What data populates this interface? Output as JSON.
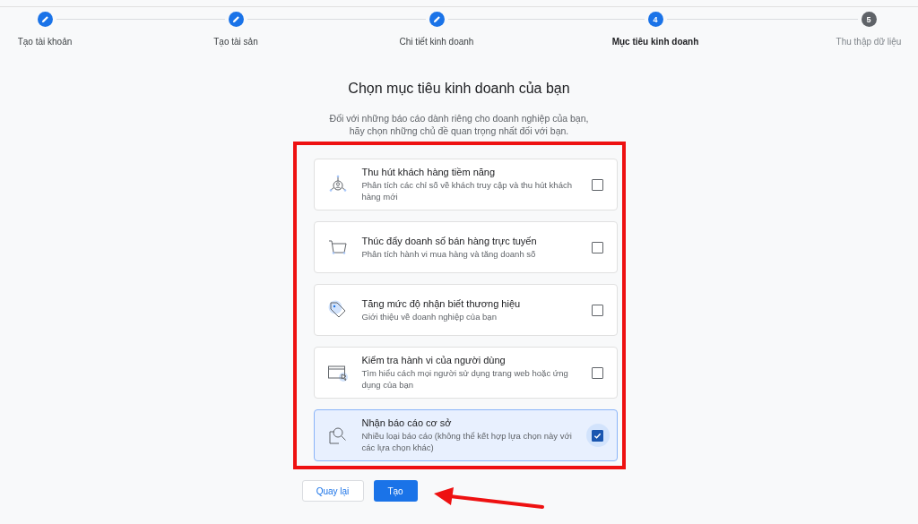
{
  "steps": [
    {
      "label": "Tạo tài khoản",
      "kind": "done"
    },
    {
      "label": "Tạo tài sản",
      "kind": "done"
    },
    {
      "label": "Chi tiết kinh doanh",
      "kind": "done"
    },
    {
      "label": "Mục tiêu kinh doanh",
      "kind": "current",
      "number": "4"
    },
    {
      "label": "Thu thập dữ liệu",
      "kind": "upcoming",
      "number": "5"
    }
  ],
  "title": "Chọn mục tiêu kinh doanh của bạn",
  "subtitle": [
    "Đối với những báo cáo dành riêng cho doanh nghiệp của bạn,",
    "hãy chọn những chủ đề quan trọng nhất đối với bạn."
  ],
  "goals": [
    {
      "kind": "leads",
      "title": "Thu hút khách hàng tiềm năng",
      "description": "Phân tích các chỉ số về khách truy cập và thu hút khách hàng mới",
      "checked": false
    },
    {
      "kind": "sales",
      "title": "Thúc đẩy doanh số bán hàng trực tuyến",
      "description": "Phân tích hành vi mua hàng và tăng doanh số",
      "checked": false
    },
    {
      "kind": "brand",
      "title": "Tăng mức độ nhận biết thương hiệu",
      "description": "Giới thiệu về doanh nghiệp của bạn",
      "checked": false
    },
    {
      "kind": "behavior",
      "title": "Kiểm tra hành vi của người dùng",
      "description": "Tìm hiểu cách mọi người sử dụng trang web hoặc ứng dụng của bạn",
      "checked": false
    },
    {
      "kind": "reports",
      "title": "Nhận báo cáo cơ sở",
      "description": "Nhiều loại báo cáo (không thể kết hợp lựa chọn này với các lựa chọn khác)",
      "checked": true
    }
  ],
  "buttons": {
    "back": "Quay lại",
    "create": "Tạo"
  }
}
